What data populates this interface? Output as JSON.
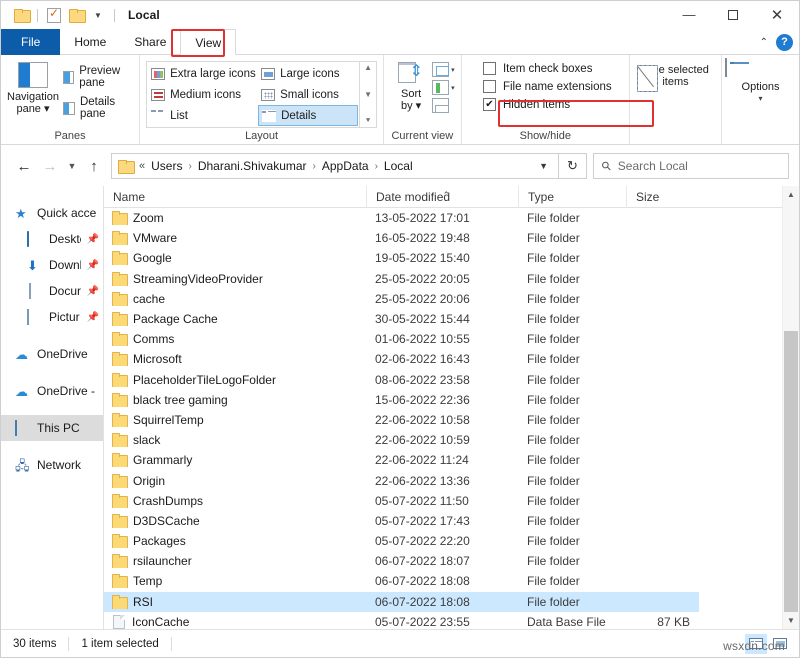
{
  "window": {
    "title": "Local",
    "quick_access": [
      "folder-icon",
      "properties-icon",
      "new-folder-icon",
      "customize-chevron"
    ],
    "controls": {
      "minimize": "minimize-icon",
      "maximize": "maximize-icon",
      "close": "close-icon"
    }
  },
  "ribbon": {
    "tabs": [
      {
        "label": "File",
        "id": "file"
      },
      {
        "label": "Home",
        "id": "home"
      },
      {
        "label": "Share",
        "id": "share"
      },
      {
        "label": "View",
        "id": "view"
      }
    ],
    "active_tab": "View",
    "highlighted_tab": "View",
    "collapse_label": "collapse-ribbon-icon",
    "help_label": "?",
    "groups": [
      {
        "name": "Panes",
        "label": "Panes",
        "big_button": {
          "label_line1": "Navigation",
          "label_line2": "pane",
          "has_dropdown": true
        },
        "small_buttons": [
          {
            "label": "Preview pane"
          },
          {
            "label": "Details pane"
          }
        ]
      },
      {
        "name": "Layout",
        "label": "Layout",
        "items": [
          {
            "label": "Extra large icons",
            "selected": false
          },
          {
            "label": "Large icons",
            "selected": false
          },
          {
            "label": "Medium icons",
            "selected": false
          },
          {
            "label": "Small icons",
            "selected": false
          },
          {
            "label": "List",
            "selected": false
          },
          {
            "label": "Details",
            "selected": true
          }
        ]
      },
      {
        "name": "Current view",
        "label": "Current view",
        "sort_by": {
          "label_line1": "Sort",
          "label_line2": "by",
          "has_dropdown": true
        }
      },
      {
        "name": "Show/hide",
        "label": "Show/hide",
        "checkboxes": [
          {
            "label": "Item check boxes",
            "checked": false
          },
          {
            "label": "File name extensions",
            "checked": false
          },
          {
            "label": "Hidden items",
            "checked": true,
            "highlighted": true
          }
        ],
        "hide_selected": {
          "label_line1": "Hide selected",
          "label_line2": "items"
        }
      },
      {
        "name": "Options",
        "label": "",
        "options_button": {
          "label": "Options",
          "has_dropdown": true
        }
      }
    ]
  },
  "addressbar": {
    "back": "back-arrow-icon",
    "forward": "forward-arrow-icon",
    "recent": "recent-locations-chevron-icon",
    "up": "up-arrow-icon",
    "breadcrumb_prefix": "«",
    "breadcrumbs": [
      "Users",
      "Dharani.Shivakumar",
      "AppData",
      "Local"
    ],
    "dropdown": "address-dropdown-chevron",
    "refresh": "refresh-icon",
    "search": {
      "placeholder": "Search Local",
      "value": "",
      "icon": "search-icon"
    }
  },
  "sidebar": {
    "items": [
      {
        "label": "Quick acce",
        "icon": "star-icon",
        "indent": false,
        "pinned": false,
        "selected": false
      },
      {
        "label": "Desktc",
        "icon": "desktop-icon",
        "indent": true,
        "pinned": true,
        "selected": false
      },
      {
        "label": "Downl",
        "icon": "downloads-icon",
        "indent": true,
        "pinned": true,
        "selected": false
      },
      {
        "label": "Docur",
        "icon": "documents-icon",
        "indent": true,
        "pinned": true,
        "selected": false
      },
      {
        "label": "Pictur",
        "icon": "pictures-icon",
        "indent": true,
        "pinned": true,
        "selected": false
      },
      {
        "label": "OneDrive",
        "icon": "onedrive-icon",
        "indent": false,
        "pinned": false,
        "selected": false,
        "gap_before": true
      },
      {
        "label": "OneDrive -",
        "icon": "onedrive-icon",
        "indent": false,
        "pinned": false,
        "selected": false,
        "gap_before": true
      },
      {
        "label": "This PC",
        "icon": "this-pc-icon",
        "indent": false,
        "pinned": false,
        "selected": true,
        "gap_before": true
      },
      {
        "label": "Network",
        "icon": "network-icon",
        "indent": false,
        "pinned": false,
        "selected": false,
        "gap_before": true
      }
    ]
  },
  "filelist": {
    "columns": [
      {
        "label": "Name",
        "sorted": false
      },
      {
        "label": "Date modified",
        "sorted": true,
        "direction": "asc"
      },
      {
        "label": "Type",
        "sorted": false
      },
      {
        "label": "Size",
        "sorted": false
      }
    ],
    "rows": [
      {
        "name": "Zoom",
        "date": "13-05-2022 17:01",
        "type": "File folder",
        "size": "",
        "kind": "folder",
        "selected": false
      },
      {
        "name": "VMware",
        "date": "16-05-2022 19:48",
        "type": "File folder",
        "size": "",
        "kind": "folder",
        "selected": false
      },
      {
        "name": "Google",
        "date": "19-05-2022 15:40",
        "type": "File folder",
        "size": "",
        "kind": "folder",
        "selected": false
      },
      {
        "name": "StreamingVideoProvider",
        "date": "25-05-2022 20:05",
        "type": "File folder",
        "size": "",
        "kind": "folder",
        "selected": false
      },
      {
        "name": "cache",
        "date": "25-05-2022 20:06",
        "type": "File folder",
        "size": "",
        "kind": "folder",
        "selected": false
      },
      {
        "name": "Package Cache",
        "date": "30-05-2022 15:44",
        "type": "File folder",
        "size": "",
        "kind": "folder",
        "selected": false
      },
      {
        "name": "Comms",
        "date": "01-06-2022 10:55",
        "type": "File folder",
        "size": "",
        "kind": "folder",
        "selected": false
      },
      {
        "name": "Microsoft",
        "date": "02-06-2022 16:43",
        "type": "File folder",
        "size": "",
        "kind": "folder",
        "selected": false
      },
      {
        "name": "PlaceholderTileLogoFolder",
        "date": "08-06-2022 23:58",
        "type": "File folder",
        "size": "",
        "kind": "folder",
        "selected": false
      },
      {
        "name": "black tree gaming",
        "date": "15-06-2022 22:36",
        "type": "File folder",
        "size": "",
        "kind": "folder",
        "selected": false
      },
      {
        "name": "SquirrelTemp",
        "date": "22-06-2022 10:58",
        "type": "File folder",
        "size": "",
        "kind": "folder",
        "selected": false
      },
      {
        "name": "slack",
        "date": "22-06-2022 10:59",
        "type": "File folder",
        "size": "",
        "kind": "folder",
        "selected": false
      },
      {
        "name": "Grammarly",
        "date": "22-06-2022 11:24",
        "type": "File folder",
        "size": "",
        "kind": "folder",
        "selected": false
      },
      {
        "name": "Origin",
        "date": "22-06-2022 13:36",
        "type": "File folder",
        "size": "",
        "kind": "folder",
        "selected": false
      },
      {
        "name": "CrashDumps",
        "date": "05-07-2022 11:50",
        "type": "File folder",
        "size": "",
        "kind": "folder",
        "selected": false
      },
      {
        "name": "D3DSCache",
        "date": "05-07-2022 17:43",
        "type": "File folder",
        "size": "",
        "kind": "folder",
        "selected": false
      },
      {
        "name": "Packages",
        "date": "05-07-2022 22:20",
        "type": "File folder",
        "size": "",
        "kind": "folder",
        "selected": false
      },
      {
        "name": "rsilauncher",
        "date": "06-07-2022 18:07",
        "type": "File folder",
        "size": "",
        "kind": "folder",
        "selected": false
      },
      {
        "name": "Temp",
        "date": "06-07-2022 18:08",
        "type": "File folder",
        "size": "",
        "kind": "folder",
        "selected": false
      },
      {
        "name": "RSI",
        "date": "06-07-2022 18:08",
        "type": "File folder",
        "size": "",
        "kind": "folder",
        "selected": true
      },
      {
        "name": "IconCache",
        "date": "05-07-2022 23:55",
        "type": "Data Base File",
        "size": "87 KB",
        "kind": "file",
        "selected": false
      }
    ]
  },
  "statusbar": {
    "item_count": "30 items",
    "selection": "1 item selected",
    "view_details": "details-view-icon",
    "view_thumbnails": "thumbnails-view-icon"
  },
  "watermark": "wsxdn.com",
  "colors": {
    "accent_blue": "#0d5ca9",
    "selection_blue": "#cce8ff",
    "highlight_red": "#e03131",
    "folder_yellow": "#fcd977"
  }
}
